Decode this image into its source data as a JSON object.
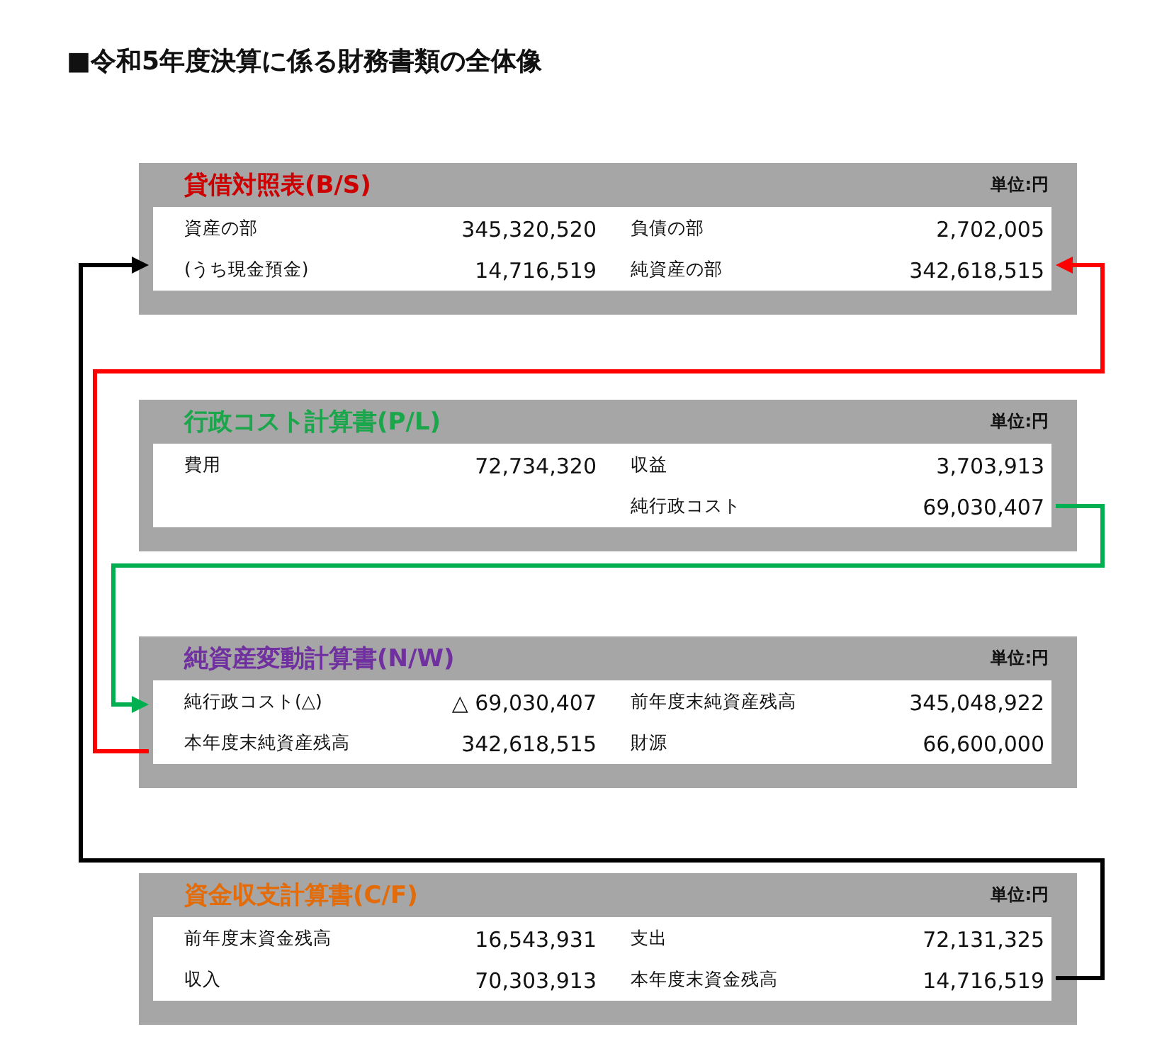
{
  "title": "■令和5年度決算に係る財務書類の全体像",
  "statements": [
    {
      "title": "貸借対照表(B/S)",
      "color": "#cc0000",
      "unit": "単位:円",
      "rows": [
        [
          "資産の部",
          "345,320,520",
          "負債の部",
          "2,702,005"
        ],
        [
          "(うち現金預金)",
          "14,716,519",
          "純資産の部",
          "342,618,515"
        ]
      ]
    },
    {
      "title": "行政コスト計算書(P/L)",
      "color": "#1ca64c",
      "unit": "単位:円",
      "rows": [
        [
          "費用",
          "72,734,320",
          "収益",
          "3,703,913"
        ],
        [
          "",
          "",
          "純行政コスト",
          "69,030,407"
        ]
      ]
    },
    {
      "title": "純資産変動計算書(N/W)",
      "color": "#7030a0",
      "unit": "単位:円",
      "rows": [
        [
          "純行政コスト(△)",
          "△ 69,030,407",
          "前年度末純資産残高",
          "345,048,922"
        ],
        [
          "本年度末純資産残高",
          "342,618,515",
          "財源",
          "66,600,000"
        ]
      ]
    },
    {
      "title": "資金収支計算書(C/F)",
      "color": "#e36c09",
      "unit": "単位:円",
      "rows": [
        [
          "前年度末資金残高",
          "16,543,931",
          "支出",
          "72,131,325"
        ],
        [
          "収入",
          "70,303,913",
          "本年度末資金残高",
          "14,716,519"
        ]
      ]
    }
  ],
  "connectors": [
    {
      "color": "#000000"
    },
    {
      "color": "#ff0000"
    },
    {
      "color": "#00b050"
    }
  ]
}
